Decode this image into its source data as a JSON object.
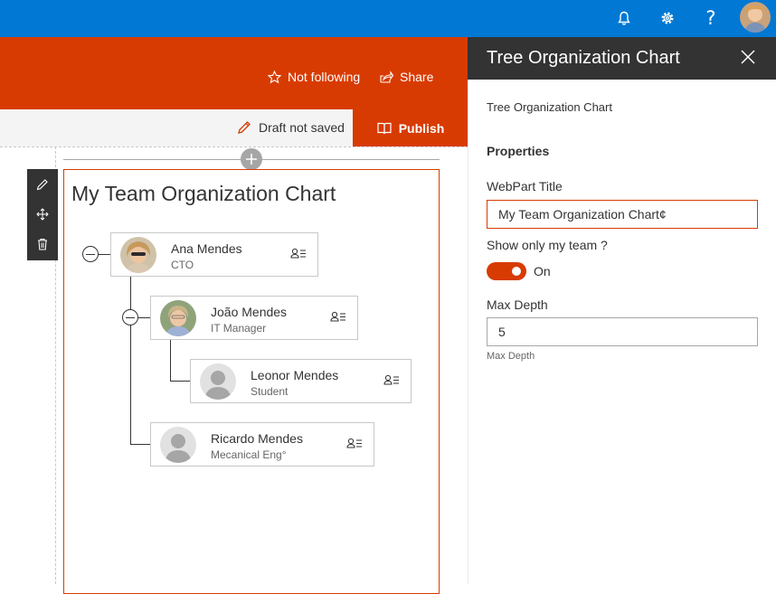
{
  "suite_bar": {
    "icons": [
      "bell-icon",
      "gear-icon",
      "help-icon"
    ],
    "help_glyph": "?",
    "avatar": "user-avatar"
  },
  "header": {
    "follow_label": "Not following",
    "share_label": "Share"
  },
  "command_bar": {
    "draft_status": "Draft not saved",
    "publish_label": "Publish"
  },
  "webpart": {
    "title": "My Team Organization Chart",
    "people": [
      {
        "name": "Ana Mendes",
        "role": "CTO"
      },
      {
        "name": "João Mendes",
        "role": "IT Manager"
      },
      {
        "name": "Leonor Mendes",
        "role": "Student"
      },
      {
        "name": "Ricardo Mendes",
        "role": "Mecanical Eng°"
      }
    ]
  },
  "property_pane": {
    "title": "Tree Organization Chart",
    "description": "Tree Organization Chart",
    "group_name": "Properties",
    "fields": {
      "webpart_title_label": "WebPart Title",
      "webpart_title_value": "My Team Organization Chart¢",
      "show_only_my_team_label": "Show only my team ?",
      "show_only_my_team_state": "On",
      "max_depth_label": "Max Depth",
      "max_depth_value": "5",
      "max_depth_hint": "Max Depth"
    }
  },
  "colors": {
    "suite_blue": "#0078d4",
    "accent_orange": "#d83b01",
    "pane_header": "#333333"
  }
}
